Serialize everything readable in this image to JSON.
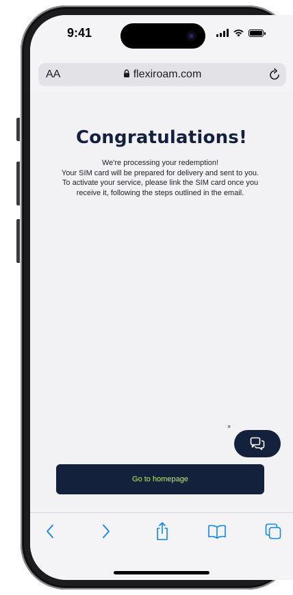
{
  "status_bar": {
    "time": "9:41"
  },
  "browser": {
    "text_size_label": "AA",
    "url": "flexiroam.com"
  },
  "page": {
    "heading": "Congratulations!",
    "message": [
      "We're processing your redemption!",
      "Your SIM card will be prepared for delivery and sent to you. To activate your service, please link the SIM card once you receive it, following the steps outlined in the email."
    ],
    "chat_close": "×",
    "cta_label": "Go to homepage"
  },
  "toolbar": {
    "icons": [
      "chevron-left-icon",
      "chevron-right-icon",
      "share-icon",
      "bookmarks-icon",
      "tabs-icon"
    ]
  },
  "colors": {
    "navy": "#14213d",
    "accent_green": "#b9f15c",
    "safari_blue": "#0a84ff"
  }
}
